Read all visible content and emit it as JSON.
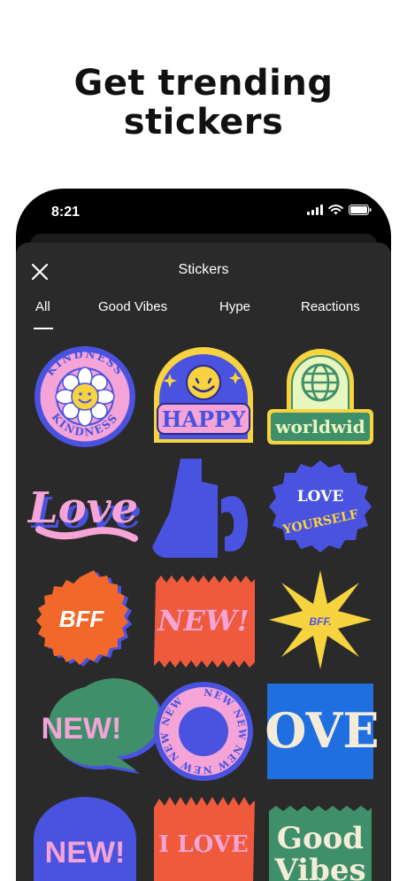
{
  "promo": {
    "headline_line1": "Get trending",
    "headline_line2": "stickers"
  },
  "status_bar": {
    "time": "8:21",
    "icons": [
      "signal-icon",
      "wifi-icon",
      "battery-icon"
    ]
  },
  "sheet": {
    "title": "Stickers",
    "close_icon": "close-icon"
  },
  "tabs": [
    {
      "label": "All",
      "selected": true
    },
    {
      "label": "Good Vibes",
      "selected": false
    },
    {
      "label": "Hype",
      "selected": false
    },
    {
      "label": "Reactions",
      "selected": false
    }
  ],
  "stickers": {
    "kindness": "KINDNESS",
    "happy": "HAPPY",
    "worldwide": "worldwid",
    "love_script": "Love",
    "love_yourself_1": "LOVE",
    "love_yourself_2": "YOURSELF",
    "bff_orange": "BFF",
    "new_red": "NEW!",
    "bff_star": "BFF.",
    "new_bubble": "NEW!",
    "new_circle": "NEW NEW NEW NEW NEW NEW",
    "ove_blue": "OVE",
    "new_arch": "NEW!",
    "i_love": "I LOVE",
    "good_vibes_1": "Good",
    "good_vibes_2": "Vibes"
  },
  "colors": {
    "phone_bg": "#000000",
    "sheet_bg": "#2a2a2a",
    "pink": "#f4a4d6",
    "blue": "#4a52e0",
    "orange": "#f2672a",
    "red": "#ef5a3d",
    "yellow": "#f8d340",
    "green": "#3f8f6a"
  }
}
